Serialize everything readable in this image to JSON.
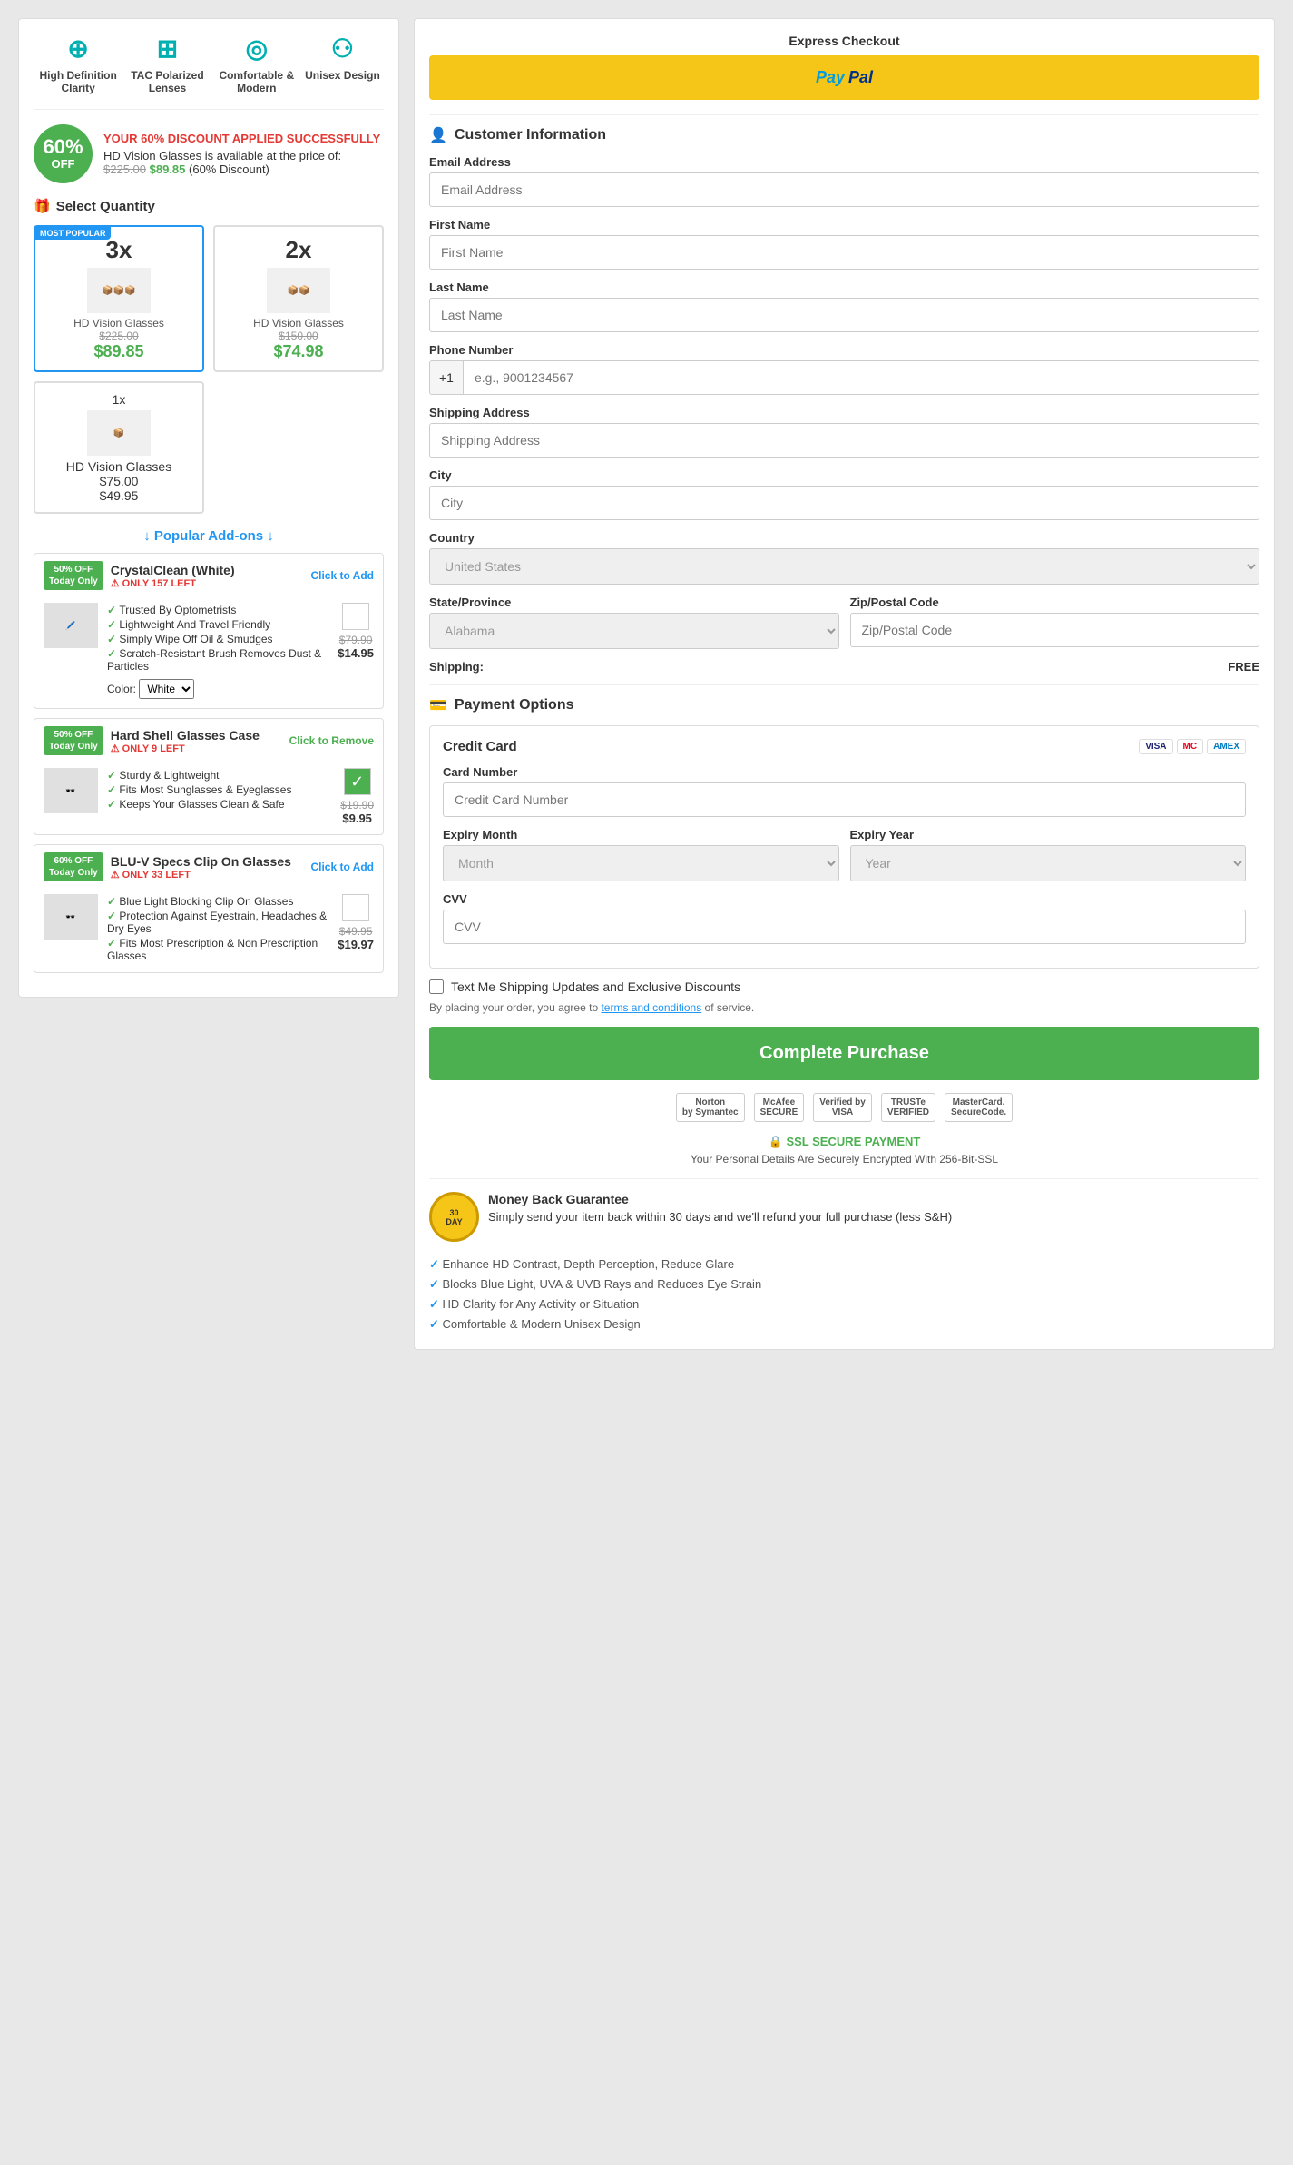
{
  "page": {
    "features": [
      {
        "icon": "⊕",
        "label": "High Definition Clarity"
      },
      {
        "icon": "⊞",
        "label": "TAC Polarized Lenses"
      },
      {
        "icon": "◎",
        "label": "Comfortable & Modern"
      },
      {
        "icon": "⚇",
        "label": "Unisex Design"
      }
    ],
    "discount": {
      "badge_pct": "60%",
      "badge_off": "OFF",
      "headline": "YOUR 60% DISCOUNT APPLIED SUCCESSFULLY",
      "description": "HD Vision Glasses is available at the price of:",
      "original_price": "$225.00",
      "sale_price": "$89.85",
      "discount_note": "(60% Discount)"
    },
    "quantity_section": {
      "title": "Select Quantity",
      "icon": "🎁",
      "options": [
        {
          "qty": "3x",
          "label": "HD Vision Glasses",
          "original": "$225.00",
          "price": "$89.85",
          "popular": true
        },
        {
          "qty": "2x",
          "label": "HD Vision Glasses",
          "original": "$150.00",
          "price": "$74.98",
          "popular": false
        },
        {
          "qty": "1x",
          "label": "HD Vision Glasses",
          "original": "$75.00",
          "price": "$49.95",
          "popular": false
        }
      ]
    },
    "addons_title": "↓ Popular Add-ons ↓",
    "addons": [
      {
        "badge_line1": "50% OFF",
        "badge_line2": "Today Only",
        "title": "CrystalClean (White)",
        "stock": "⚠ ONLY 157 LEFT",
        "action": "Click to Add",
        "added": false,
        "features": [
          "Trusted By Optometrists",
          "Lightweight And Travel Friendly",
          "Simply Wipe Off Oil & Smudges",
          "Scratch-Resistant Brush Removes Dust & Particles"
        ],
        "color_label": "Color:",
        "color_option": "White",
        "original_price": "$79.90",
        "sale_price": "$14.95"
      },
      {
        "badge_line1": "50% OFF",
        "badge_line2": "Today Only",
        "title": "Hard Shell Glasses Case",
        "stock": "⚠ ONLY 9 LEFT",
        "action": "Click to Remove",
        "added": true,
        "features": [
          "Sturdy & Lightweight",
          "Fits Most Sunglasses & Eyeglasses",
          "Keeps Your Glasses Clean & Safe"
        ],
        "color_label": "",
        "color_option": "",
        "original_price": "$19.90",
        "sale_price": "$9.95"
      },
      {
        "badge_line1": "60% OFF",
        "badge_line2": "Today Only",
        "title": "BLU-V Specs Clip On Glasses",
        "stock": "⚠ ONLY 33 LEFT",
        "action": "Click to Add",
        "added": false,
        "features": [
          "Blue Light Blocking Clip On Glasses",
          "Protection Against Eyestrain, Headaches & Dry Eyes",
          "Fits Most Prescription & Non Prescription Glasses"
        ],
        "color_label": "",
        "color_option": "",
        "original_price": "$49.95",
        "sale_price": "$19.97"
      }
    ],
    "checkout": {
      "express_title": "Express Checkout",
      "paypal_label": "PayPal",
      "customer_section": "Customer Information",
      "fields": {
        "email_label": "Email Address",
        "email_placeholder": "Email Address",
        "firstname_label": "First Name",
        "firstname_placeholder": "First Name",
        "lastname_label": "Last Name",
        "lastname_placeholder": "Last Name",
        "phone_label": "Phone Number",
        "phone_prefix": "+1",
        "phone_placeholder": "e.g., 9001234567",
        "address_label": "Shipping Address",
        "address_placeholder": "Shipping Address",
        "city_label": "City",
        "city_placeholder": "City",
        "country_label": "Country",
        "country_value": "United States",
        "state_label": "State/Province",
        "state_value": "Alabama",
        "zip_label": "Zip/Postal Code",
        "zip_placeholder": "Zip/Postal Code",
        "shipping_label": "Shipping:",
        "shipping_value": "FREE"
      },
      "payment": {
        "section_title": "Payment Options",
        "card_title": "Credit Card",
        "card_icons": [
          "VISA",
          "MC",
          "AMEX"
        ],
        "card_number_label": "Card Number",
        "card_number_placeholder": "Credit Card Number",
        "expiry_month_label": "Expiry Month",
        "expiry_month_placeholder": "Month",
        "expiry_year_label": "Expiry Year",
        "expiry_year_placeholder": "Year",
        "cvv_label": "CVV",
        "cvv_placeholder": "CVV"
      },
      "checkbox_label": "Text Me Shipping Updates and Exclusive Discounts",
      "terms_text": "By placing your order, you agree to",
      "terms_link": "terms and conditions",
      "terms_suffix": "of service.",
      "complete_btn": "Complete Purchase",
      "security_badges": [
        "Norton\nby Symantec",
        "McAfee\nSECURE",
        "Verified by\nVISA",
        "TRUSTe\nVERIFIED",
        "MasterCard.\nSecureCode."
      ],
      "ssl_title": "🔒 SSL SECURE PAYMENT",
      "ssl_desc": "Your Personal Details Are Securely Encrypted With 256-Bit-SSL",
      "money_back_badge_top": "30",
      "money_back_badge_bottom": "DAY",
      "money_back_title": "Money Back Guarantee",
      "money_back_desc": "Simply send your item back within 30 days and we'll refund your full purchase (less S&H)",
      "benefits": [
        "Enhance HD Contrast, Depth Perception, Reduce Glare",
        "Blocks Blue Light, UVA & UVB Rays and Reduces Eye Strain",
        "HD Clarity for Any Activity or Situation",
        "Comfortable & Modern Unisex Design"
      ]
    }
  }
}
